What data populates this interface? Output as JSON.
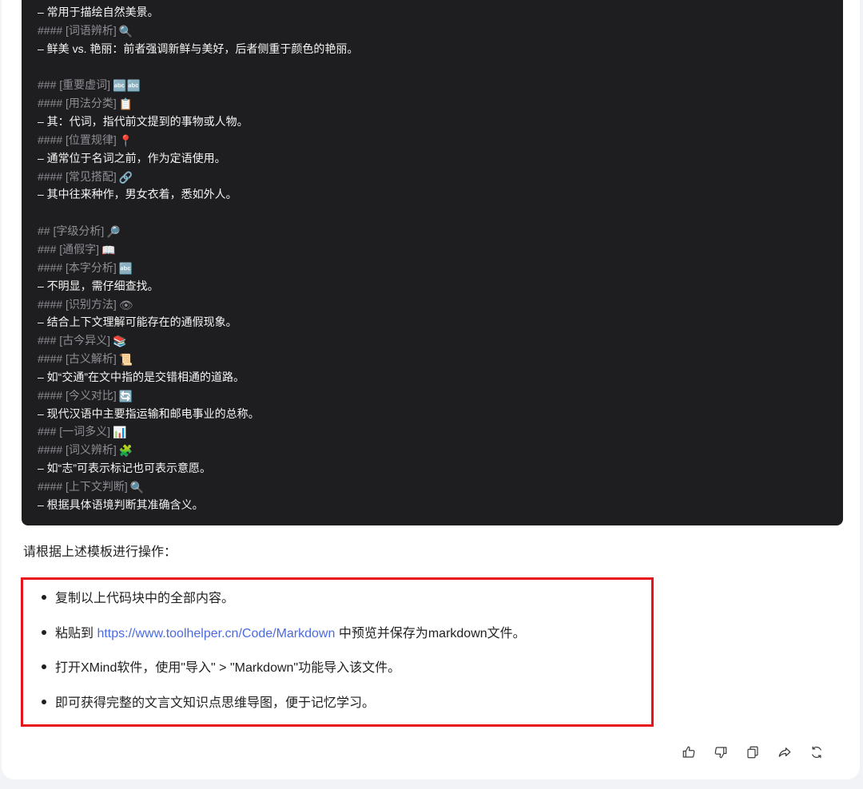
{
  "code": {
    "lines": [
      {
        "text": "– 常用于描绘自然美景。",
        "kind": "t",
        "icon": "",
        "icon_name": ""
      },
      {
        "text": "#### [词语辨析]",
        "kind": "h",
        "icon": "🔍",
        "icon_name": "magnifier-icon"
      },
      {
        "text": "– 鲜美 vs. 艳丽：前者强调新鲜与美好，后者侧重于颜色的艳丽。",
        "kind": "t",
        "icon": "",
        "icon_name": ""
      },
      {
        "text": "",
        "kind": "t",
        "icon": "",
        "icon_name": ""
      },
      {
        "text": "### [重要虚词]",
        "kind": "h",
        "icon": "🔤🔤",
        "icon_name": "abc-icon"
      },
      {
        "text": "#### [用法分类]",
        "kind": "h",
        "icon": "📋",
        "icon_name": "clipboard-icon"
      },
      {
        "text": "– 其：代词，指代前文提到的事物或人物。",
        "kind": "t",
        "icon": "",
        "icon_name": ""
      },
      {
        "text": "#### [位置规律]",
        "kind": "h",
        "icon": "📍",
        "icon_name": "pin-icon"
      },
      {
        "text": "– 通常位于名词之前，作为定语使用。",
        "kind": "t",
        "icon": "",
        "icon_name": ""
      },
      {
        "text": "#### [常见搭配]",
        "kind": "h",
        "icon": "🔗",
        "icon_name": "link-icon"
      },
      {
        "text": "– 其中往来种作，男女衣着，悉如外人。",
        "kind": "t",
        "icon": "",
        "icon_name": ""
      },
      {
        "text": "",
        "kind": "t",
        "icon": "",
        "icon_name": ""
      },
      {
        "text": "## [字级分析]",
        "kind": "h",
        "icon": "🔎",
        "icon_name": "magnifier-right-icon"
      },
      {
        "text": "### [通假字]",
        "kind": "h",
        "icon": "📖",
        "icon_name": "open-book-icon"
      },
      {
        "text": "#### [本字分析]",
        "kind": "h",
        "icon": "🔤",
        "icon_name": "abc-icon"
      },
      {
        "text": "– 不明显，需仔细查找。",
        "kind": "t",
        "icon": "",
        "icon_name": ""
      },
      {
        "text": "#### [识别方法]",
        "kind": "h",
        "icon": "👁",
        "icon_name": "eye-icon"
      },
      {
        "text": "– 结合上下文理解可能存在的通假现象。",
        "kind": "t",
        "icon": "",
        "icon_name": ""
      },
      {
        "text": "### [古今异义]",
        "kind": "h",
        "icon": "📚",
        "icon_name": "books-icon"
      },
      {
        "text": "#### [古义解析]",
        "kind": "h",
        "icon": "📜",
        "icon_name": "scroll-icon"
      },
      {
        "text": "– 如“交通”在文中指的是交错相通的道路。",
        "kind": "t",
        "icon": "",
        "icon_name": ""
      },
      {
        "text": "#### [今义对比]",
        "kind": "h",
        "icon": "🔄",
        "icon_name": "refresh-icon"
      },
      {
        "text": "– 现代汉语中主要指运输和邮电事业的总称。",
        "kind": "t",
        "icon": "",
        "icon_name": ""
      },
      {
        "text": "### [一词多义]",
        "kind": "h",
        "icon": "📊",
        "icon_name": "bar-chart-icon"
      },
      {
        "text": "#### [词义辨析]",
        "kind": "h",
        "icon": "🧩",
        "icon_name": "puzzle-icon"
      },
      {
        "text": "– 如“志”可表示标记也可表示意愿。",
        "kind": "t",
        "icon": "",
        "icon_name": ""
      },
      {
        "text": "#### [上下文判断]",
        "kind": "h",
        "icon": "🔍",
        "icon_name": "magnifier-icon"
      },
      {
        "text": "– 根据具体语境判断其准确含义。",
        "kind": "t",
        "icon": "",
        "icon_name": ""
      }
    ]
  },
  "instruction": "请根据上述模板进行操作：",
  "steps": {
    "items": [
      {
        "before": "复制以上代码块中的全部内容。",
        "link": "",
        "after": ""
      },
      {
        "before": "粘贴到 ",
        "link": "https://www.toolhelper.cn/Code/Markdown",
        "after": " 中预览并保存为markdown文件。"
      },
      {
        "before": "打开XMind软件，使用\"导入\" > \"Markdown\"功能导入该文件。",
        "link": "",
        "after": ""
      },
      {
        "before": "即可获得完整的文言文知识点思维导图，便于记忆学习。",
        "link": "",
        "after": ""
      }
    ]
  },
  "actions": [
    {
      "name": "thumbs-up-icon"
    },
    {
      "name": "thumbs-down-icon"
    },
    {
      "name": "copy-icon"
    },
    {
      "name": "share-icon"
    },
    {
      "name": "regenerate-icon"
    }
  ],
  "colors": {
    "code_bg": "#1e1e20",
    "heading_text": "#8e8e94",
    "highlight_border": "#e8121b",
    "link": "#4b6ae0"
  }
}
